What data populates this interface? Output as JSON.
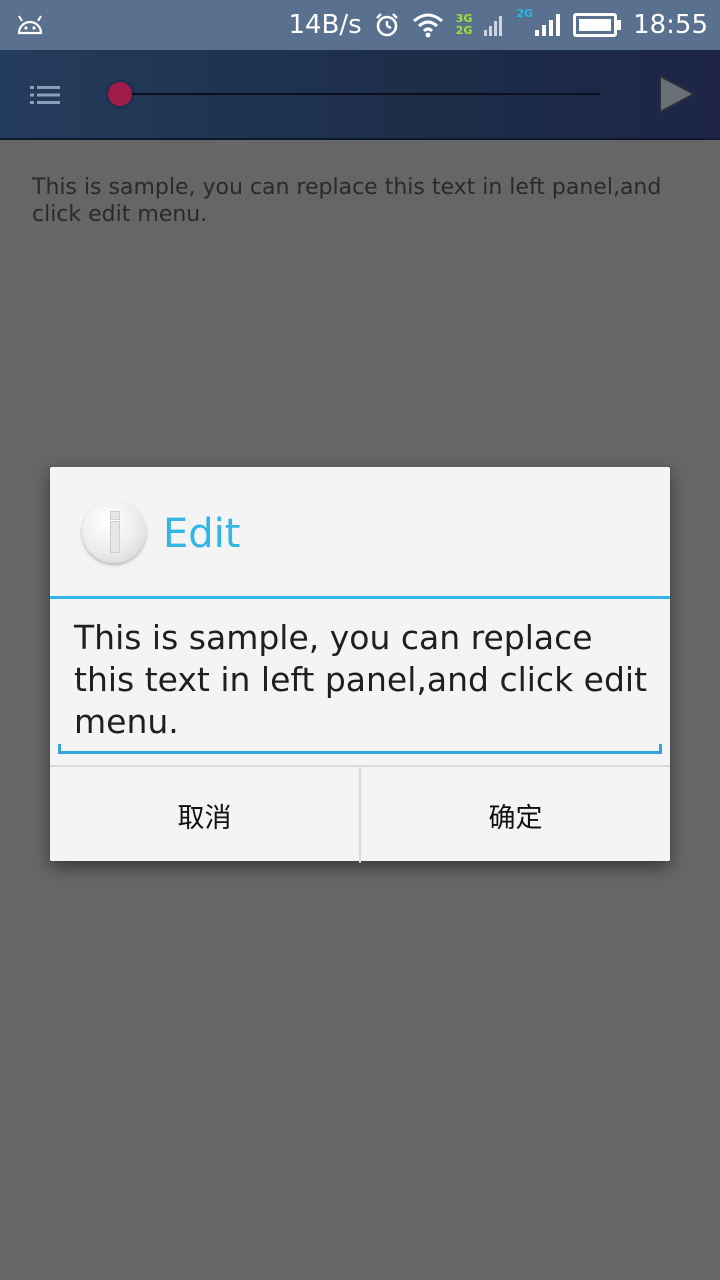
{
  "status_bar": {
    "net_speed": "14B/s",
    "badge_3g": "3G",
    "badge_2g_a": "2G",
    "badge_2g_b": "2G",
    "time": "18:55"
  },
  "toolbar": {
    "icons": [
      "menu-icon",
      "play-icon"
    ],
    "seek_progress": 0.0
  },
  "content": {
    "text": "This is sample, you can replace this text in left panel,and click edit menu."
  },
  "dialog": {
    "icon": "info-icon",
    "title": "Edit",
    "field_value": "This is sample, you can replace this text in left panel,and click edit menu.",
    "cancel_label": "取消",
    "ok_label": "确定"
  },
  "colors": {
    "accent": "#33b5e5",
    "status_bar": "#59718e",
    "toolbar": "#1c2d49",
    "seek_thumb": "#a01a4a",
    "dim_background": "#666666",
    "dialog_bg": "#f4f4f4"
  }
}
